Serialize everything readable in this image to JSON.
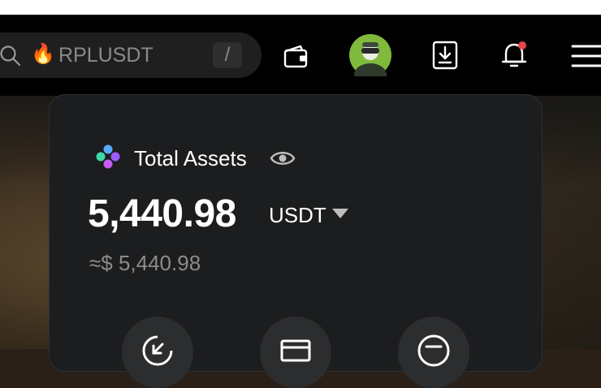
{
  "search": {
    "trending": "RPLUSDT",
    "shortcut": "/"
  },
  "header_icons": [
    "wallet-icon",
    "avatar",
    "download-icon",
    "bell-icon",
    "menu-icon"
  ],
  "notification_dot_color": "#e5484d",
  "assets": {
    "title": "Total Assets",
    "amount": "5,440.98",
    "currency": "USDT",
    "approx": "≈$ 5,440.98"
  },
  "actions": [
    "deposit-icon",
    "withdraw-icon",
    "transfer-icon"
  ]
}
